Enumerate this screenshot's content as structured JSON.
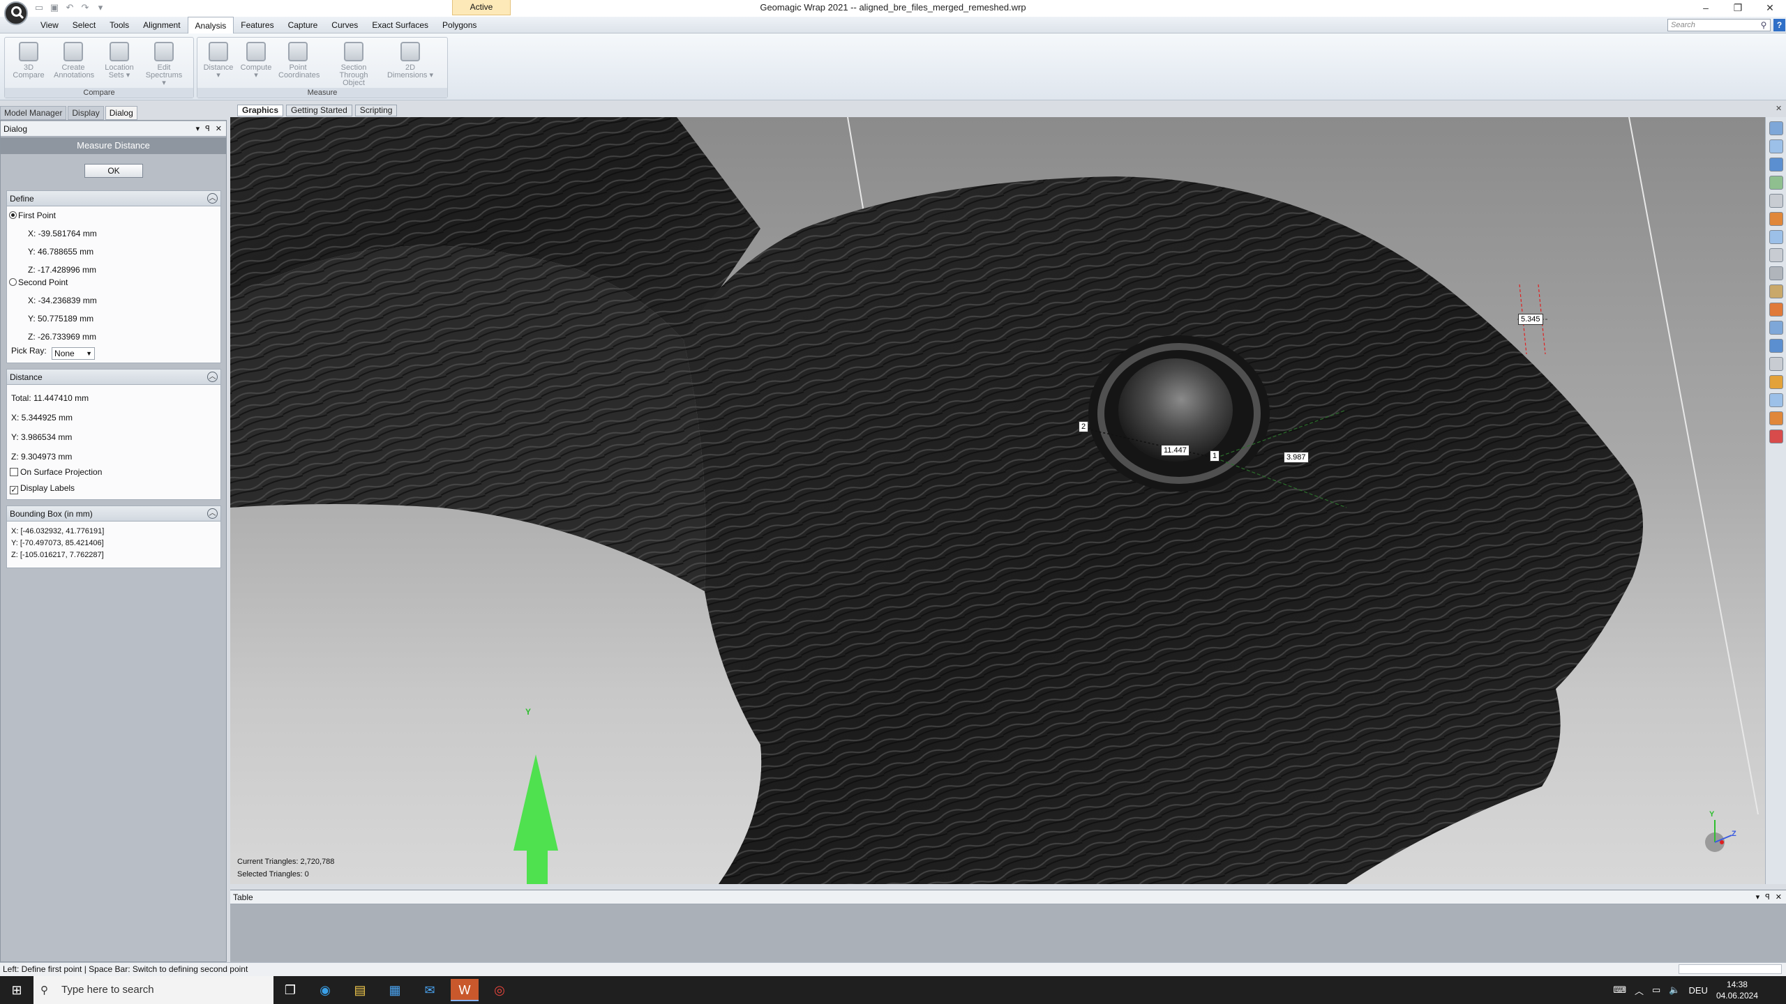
{
  "window": {
    "title": "Geomagic Wrap 2021 -- aligned_bre_files_merged_remeshed.wrp",
    "active_tab": "Active",
    "controls": [
      "–",
      "❐",
      "✕"
    ]
  },
  "menu": {
    "items": [
      "View",
      "Select",
      "Tools",
      "Alignment",
      "Analysis",
      "Features",
      "Capture",
      "Curves",
      "Exact Surfaces",
      "Polygons"
    ],
    "selected": "Analysis",
    "search_placeholder": "Search"
  },
  "ribbon": {
    "compare_group": {
      "label": "Compare",
      "buttons": [
        {
          "line1": "3D",
          "line2": "Compare"
        },
        {
          "line1": "Create",
          "line2": "Annotations"
        },
        {
          "line1": "Location",
          "line2": "Sets ▾"
        },
        {
          "line1": "Edit",
          "line2": "Spectrums ▾"
        }
      ]
    },
    "measure_group": {
      "label": "Measure",
      "buttons": [
        {
          "line1": "Distance",
          "line2": "▾"
        },
        {
          "line1": "Compute",
          "line2": "▾"
        },
        {
          "line1": "Point",
          "line2": "Coordinates"
        },
        {
          "line1": "Section Through",
          "line2": "Object"
        },
        {
          "line1": "2D",
          "line2": "Dimensions ▾"
        }
      ]
    }
  },
  "left_tabs": [
    "Model Manager",
    "Display",
    "Dialog"
  ],
  "dialog": {
    "header": "Dialog",
    "header_controls": [
      "▾",
      "ꟼ",
      "✕"
    ],
    "title": "Measure Distance",
    "ok_label": "OK",
    "define": {
      "label": "Define",
      "first_point_label": "First Point",
      "first_x": "X: -39.581764 mm",
      "first_y": "Y: 46.788655 mm",
      "first_z": "Z: -17.428996 mm",
      "second_point_label": "Second Point",
      "second_x": "X: -34.236839 mm",
      "second_y": "Y: 50.775189 mm",
      "second_z": "Z: -26.733969 mm",
      "pick_ray_label": "Pick Ray:",
      "pick_ray_value": "None"
    },
    "distance": {
      "label": "Distance",
      "total": "Total: 11.447410 mm",
      "x": "X: 5.344925 mm",
      "y": "Y: 3.986534 mm",
      "z": "Z: 9.304973 mm",
      "surface_projection_label": "On Surface Projection",
      "surface_projection_checked": false,
      "display_labels_label": "Display Labels",
      "display_labels_checked": true
    },
    "bounding_box": {
      "label": "Bounding Box (in mm)",
      "x": "X: [-46.032932, 41.776191]",
      "y": "Y: [-70.497073, 85.421406]",
      "z": "Z: [-105.016217, 7.762287]"
    }
  },
  "viewport": {
    "tabs": [
      "Graphics",
      "Getting Started",
      "Scripting"
    ],
    "selected_tab": "Graphics",
    "current_triangles": "Current Triangles: 2,720,788",
    "selected_triangles": "Selected Triangles: 0",
    "labels": {
      "point2": "2",
      "point1": "1",
      "total": "11.447",
      "dy": "3.987",
      "dx": "5.345"
    },
    "axis_label": "Y",
    "triad": {
      "y": "Y",
      "z": "Z"
    }
  },
  "table_pane": {
    "title": "Table",
    "controls": [
      "▾",
      "ꟼ",
      "✕"
    ]
  },
  "status": {
    "text": "Left: Define first point | Space Bar: Switch to defining second point"
  },
  "taskbar": {
    "search_placeholder": "Type here to search",
    "language": "DEU",
    "time": "14:38",
    "date": "04.06.2024"
  },
  "colors": {
    "accent": "#2f6fc7",
    "active_tab_bg": "#fde9b8",
    "arrow_green": "#4fe14f"
  }
}
